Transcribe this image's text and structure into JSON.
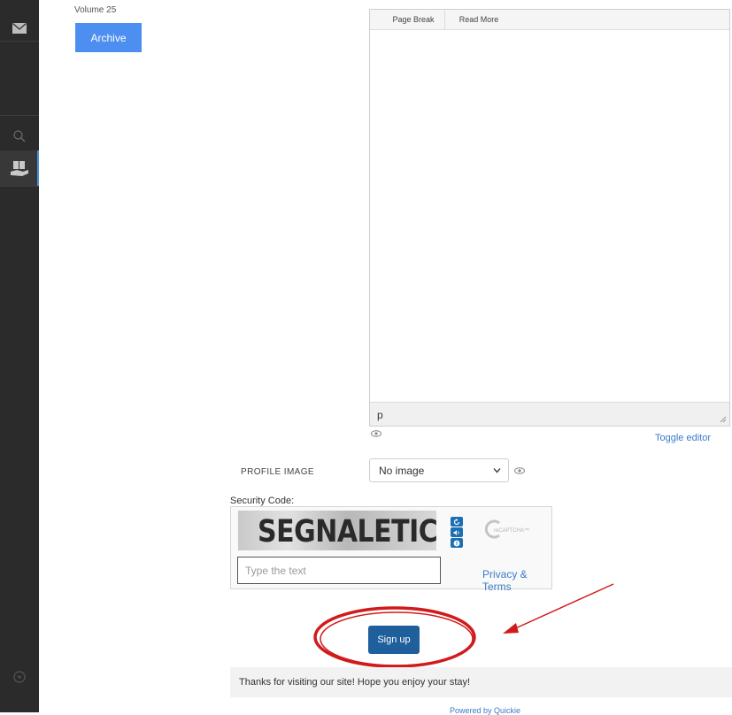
{
  "sidebar": {
    "icons": [
      "mail-icon",
      "search-icon",
      "book-hand-icon",
      "circle-icon"
    ],
    "active_color": "#4a90d9"
  },
  "archive": {
    "volume_label": "Volume 25",
    "button_label": "Archive"
  },
  "editor": {
    "toolbar": {
      "page_break_label": "Page Break",
      "read_more_label": "Read More"
    },
    "path_label": "p",
    "toggle_label": "Toggle editor"
  },
  "profile_image": {
    "label": "PROFILE IMAGE",
    "selected": "No image"
  },
  "captcha": {
    "label": "Security Code:",
    "image_text": "SEGNALETICA",
    "input_placeholder": "Type the text",
    "privacy_link": "Privacy & Terms",
    "logo_text": "reCAPTCHA™"
  },
  "signup": {
    "button_label": "Sign up"
  },
  "footer": {
    "message": "Thanks for visiting our site! Hope you enjoy your stay!",
    "powered": "Powered by Quickie"
  },
  "colors": {
    "accent": "#4d8ff0",
    "signup": "#1f5f9c",
    "annotation_red": "#d11a1a",
    "link": "#3a7bc8"
  }
}
